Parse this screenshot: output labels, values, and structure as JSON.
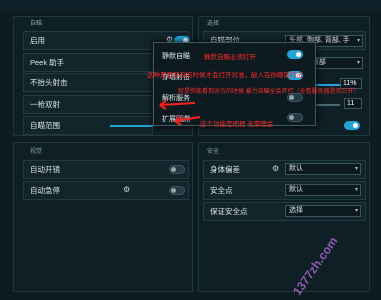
{
  "left_top": {
    "section_title": "自瞄",
    "items": [
      {
        "label": "启用",
        "toggle": true
      },
      {
        "label": "Peek 助手"
      },
      {
        "label": "不抬头射击"
      },
      {
        "label": "一枪双射"
      },
      {
        "label": "自瞄范围"
      }
    ]
  },
  "right_top": {
    "section_title": "选择",
    "items": [
      {
        "label": "自瞄部位",
        "select": "头部, 胸部, 背部, 手"
      },
      {
        "label": "",
        "select": "头部, 背部"
      },
      {
        "label": "",
        "value": "11%"
      },
      {
        "label": "",
        "value": "11"
      },
      {
        "label": "",
        "toggle": true
      }
    ]
  },
  "popup": {
    "btn_static_aim": "静默自瞄",
    "btn_wallbang": "穿墙射击",
    "btn_backtrack": "解析服务",
    "btn_expand": "扩展回溯"
  },
  "annotations": {
    "a1": "静默自瞄必须打开",
    "a2": "这种是要开启的时候才会打开对准，敌人在你眼前打击",
    "a3": "就是你能看到对方的时候 暴力自瞄全会开打（全看服务器是否公开）",
    "a4": "这个功能是把把 无需理会"
  },
  "left_bottom": {
    "section_title": "视觉",
    "items": [
      {
        "label": "自动开镜"
      },
      {
        "label": "自动急停"
      }
    ]
  },
  "right_bottom": {
    "section_title": "安全",
    "items": [
      {
        "label": "身体偏差",
        "select": "默认"
      },
      {
        "label": "安全点",
        "select": "默认"
      },
      {
        "label": "保证安全点",
        "select": "选择"
      }
    ]
  },
  "watermark": "1377zh.com",
  "colors": {
    "accent": "#23a3d6",
    "annotation": "#ff2a2a",
    "background": "#0c1c22"
  }
}
